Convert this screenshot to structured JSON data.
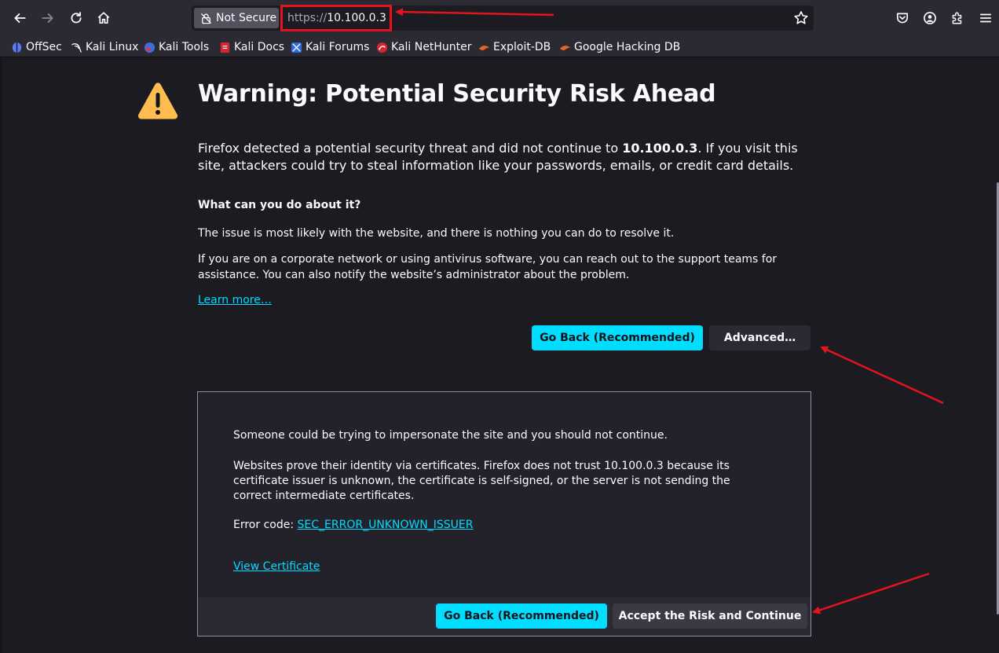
{
  "toolbar": {
    "back_icon": "arrow-left-icon",
    "forward_icon": "arrow-right-icon",
    "reload_icon": "reload-icon",
    "home_icon": "home-icon",
    "not_secure_label": "Not Secure",
    "url_scheme": "https://",
    "url_host": "10.100.0.3",
    "bookmark_star_icon": "star-icon",
    "right_icons": [
      "pocket-icon",
      "account-icon",
      "extensions-icon",
      "menu-icon"
    ]
  },
  "bookmarks": [
    {
      "label": "OffSec",
      "icon": "offsec-icon"
    },
    {
      "label": "Kali Linux",
      "icon": "kali-dragon-icon"
    },
    {
      "label": "Kali Tools",
      "icon": "kali-tools-icon"
    },
    {
      "label": "Kali Docs",
      "icon": "kali-docs-icon"
    },
    {
      "label": "Kali Forums",
      "icon": "kali-forums-icon"
    },
    {
      "label": "Kali NetHunter",
      "icon": "nethunter-icon"
    },
    {
      "label": "Exploit-DB",
      "icon": "exploit-db-icon"
    },
    {
      "label": "Google Hacking DB",
      "icon": "ghdb-icon"
    }
  ],
  "page": {
    "title": "Warning: Potential Security Risk Ahead",
    "intro_before": "Firefox detected a potential security threat and did not continue to ",
    "intro_host": "10.100.0.3",
    "intro_after": ". If you visit this site, attackers could try to steal information like your passwords, emails, or credit card details.",
    "what_heading": "What can you do about it?",
    "para1": "The issue is most likely with the website, and there is nothing you can do to resolve it.",
    "para2": "If you are on a corporate network or using antivirus software, you can reach out to the support teams for assistance. You can also notify the website’s administrator about the problem.",
    "learn_more": "Learn more…",
    "go_back": "Go Back (Recommended)",
    "advanced": "Advanced…"
  },
  "advanced_panel": {
    "line1": "Someone could be trying to impersonate the site and you should not continue.",
    "line2": "Websites prove their identity via certificates. Firefox does not trust 10.100.0.3 because its certificate issuer is unknown, the certificate is self-signed, or the server is not sending the correct intermediate certificates.",
    "error_label": "Error code: ",
    "error_code": "SEC_ERROR_UNKNOWN_ISSUER",
    "view_certificate": "View Certificate",
    "go_back": "Go Back (Recommended)",
    "accept": "Accept the Risk and Continue"
  },
  "colors": {
    "accent": "#00ddff",
    "warning": "#ffbd4f",
    "annotation": "#e3141b",
    "background": "#1c1b22",
    "toolbar": "#2b2a33"
  }
}
